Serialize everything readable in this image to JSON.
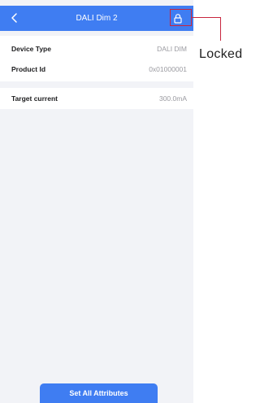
{
  "header": {
    "title": "DALI Dim 2",
    "back_icon": "back-arrow-icon",
    "lock_icon": "lock-icon"
  },
  "device_info": {
    "rows": [
      {
        "label": "Device Type",
        "value": "DALI DIM"
      },
      {
        "label": "Product Id",
        "value": "0x01000001"
      }
    ]
  },
  "attributes": {
    "rows": [
      {
        "label": "Target current",
        "value": "300.0mA"
      }
    ]
  },
  "footer": {
    "set_all_label": "Set All Attributes"
  },
  "annotation": {
    "label": "Locked",
    "color": "#c8263f"
  },
  "colors": {
    "accent": "#3f7df2",
    "background": "#f2f3f7"
  }
}
